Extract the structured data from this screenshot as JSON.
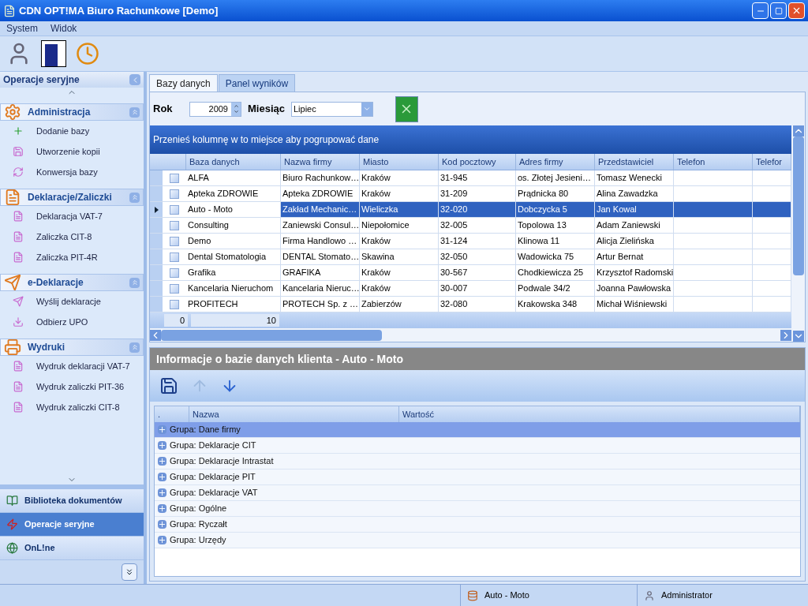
{
  "window": {
    "title": "CDN OPT!MA Biuro Rachunkowe [Demo]"
  },
  "menu": [
    "System",
    "Widok"
  ],
  "sidebar": {
    "title": "Operacje seryjne",
    "sections": [
      {
        "title": "Administracja",
        "expanded": true,
        "items": [
          "Dodanie bazy",
          "Utworzenie kopii",
          "Konwersja bazy"
        ]
      },
      {
        "title": "Deklaracje/Zaliczki",
        "expanded": true,
        "items": [
          "Deklaracja VAT-7",
          "Zaliczka CIT-8",
          "Zaliczka PIT-4R"
        ]
      },
      {
        "title": "e-Deklaracje",
        "expanded": true,
        "items": [
          "Wyślij deklaracje",
          "Odbierz UPO"
        ]
      },
      {
        "title": "Wydruki",
        "expanded": true,
        "items": [
          "Wydruk deklaracji VAT-7",
          "Wydruk zaliczki PIT-36",
          "Wydruk zaliczki CIT-8"
        ]
      }
    ],
    "nav": [
      {
        "label": "Biblioteka dokumentów",
        "selected": false
      },
      {
        "label": "Operacje seryjne",
        "selected": true
      },
      {
        "label": "OnL!ne",
        "selected": false
      }
    ]
  },
  "tabs": [
    {
      "label": "Bazy danych",
      "selected": true
    },
    {
      "label": "Panel wyników",
      "selected": false
    }
  ],
  "filter": {
    "year_label": "Rok",
    "year": "2009",
    "month_label": "Miesiąc",
    "month": "Lipiec"
  },
  "grid": {
    "group_hint": "Przenieś kolumnę w to miejsce aby pogrupować dane",
    "columns": [
      "Baza danych",
      "Nazwa firmy",
      "Miasto",
      "Kod pocztowy",
      "Adres firmy",
      "Przedstawiciel",
      "Telefon",
      "Telefor"
    ],
    "rows": [
      {
        "selected": false,
        "checked": false,
        "cells": [
          "ALFA",
          "Biuro Rachunkow…",
          "Kraków",
          "31-945",
          "os. Złotej Jesieni…",
          "Tomasz Wenecki"
        ]
      },
      {
        "selected": false,
        "checked": false,
        "cells": [
          "Apteka ZDROWIE",
          "Apteka ZDROWIE",
          "Kraków",
          "31-209",
          "Prądnicka 80",
          "Alina Zawadzka"
        ]
      },
      {
        "selected": true,
        "checked": false,
        "cells": [
          "Auto - Moto",
          "Zakład Mechanic…",
          "Wieliczka",
          "32-020",
          "Dobczycka 5",
          "Jan Kowal"
        ]
      },
      {
        "selected": false,
        "checked": false,
        "cells": [
          "Consulting",
          "Zaniewski Consul…",
          "Niepołomice",
          "32-005",
          "Topolowa 13",
          "Adam Zaniewski"
        ]
      },
      {
        "selected": false,
        "checked": false,
        "cells": [
          "Demo",
          "Firma Handlowo …",
          "Kraków",
          "31-124",
          "Klinowa 11",
          "Alicja Zielińska"
        ]
      },
      {
        "selected": false,
        "checked": false,
        "cells": [
          "Dental Stomatologia",
          "DENTAL Stomato…",
          "Skawina",
          "32-050",
          "Wadowicka 75",
          "Artur Bernat"
        ]
      },
      {
        "selected": false,
        "checked": false,
        "cells": [
          "Grafika",
          "GRAFIKA",
          "Kraków",
          "30-567",
          "Chodkiewicza 25",
          "Krzysztof Radomski"
        ]
      },
      {
        "selected": false,
        "checked": false,
        "cells": [
          "Kancelaria Nieruchom",
          "Kancelaria Nieruc…",
          "Kraków",
          "30-007",
          "Podwale 34/2",
          "Joanna Pawłowska"
        ]
      },
      {
        "selected": false,
        "checked": false,
        "cells": [
          "PROFITECH",
          "PROTECH Sp. z …",
          "Zabierzów",
          "32-080",
          "Krakowska 348",
          "Michał Wiśniewski"
        ]
      }
    ],
    "footer": [
      "0",
      "10"
    ]
  },
  "info": {
    "title": "Informacje o bazie danych klienta - Auto - Moto",
    "columns": [
      ".",
      "Nazwa",
      "Wartość"
    ],
    "groups": [
      {
        "label": "Grupa: Dane firmy",
        "selected": true
      },
      {
        "label": "Grupa: Deklaracje CIT",
        "selected": false
      },
      {
        "label": "Grupa: Deklaracje Intrastat",
        "selected": false
      },
      {
        "label": "Grupa: Deklaracje PIT",
        "selected": false
      },
      {
        "label": "Grupa: Deklaracje VAT",
        "selected": false
      },
      {
        "label": "Grupa: Ogólne",
        "selected": false
      },
      {
        "label": "Grupa: Ryczałt",
        "selected": false
      },
      {
        "label": "Grupa: Urzędy",
        "selected": false
      }
    ]
  },
  "status_bar": {
    "database": "Auto - Moto",
    "user": "Administrator"
  }
}
